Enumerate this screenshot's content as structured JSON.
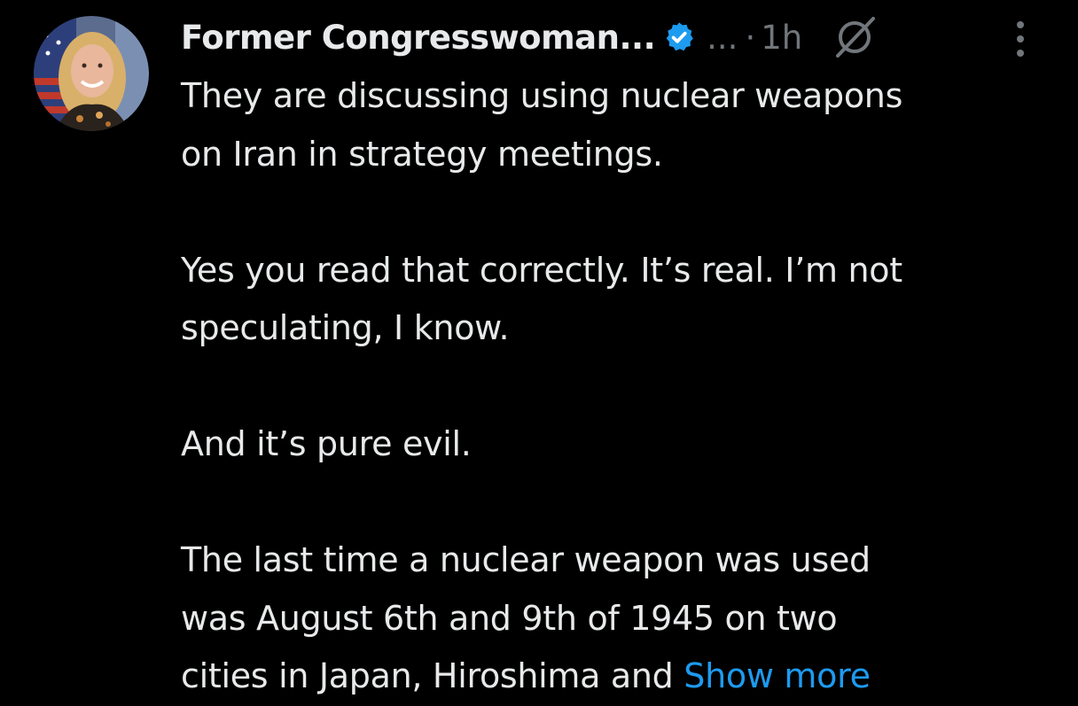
{
  "tweet": {
    "display_name": "Former Congresswoman...",
    "handle": "...",
    "separator": "·",
    "time": "1h",
    "paragraphs": [
      "They are discussing using nuclear weapons\non Iran in strategy meetings.",
      "Yes you read that correctly.  It’s real.  I’m not\nspeculating, I know.",
      "And it’s pure evil.",
      "The last time a nuclear weapon was used\nwas August 6th and 9th of 1945 on two\ncities in Japan, Hiroshima and "
    ],
    "show_more_label": "Show more"
  },
  "icons": {
    "verified": "verified-badge-icon",
    "grok": "grok-icon",
    "more": "more-options-icon"
  },
  "colors": {
    "background": "#000000",
    "text": "#e7e9ea",
    "secondary": "#71767b",
    "accent": "#1d9bf0"
  }
}
